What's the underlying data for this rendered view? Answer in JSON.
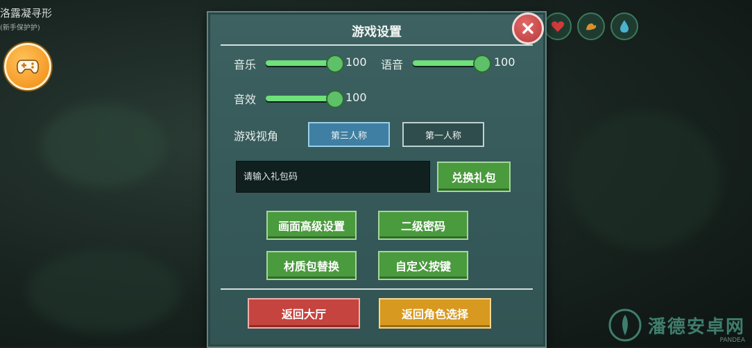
{
  "hud": {
    "quest_title": "洛露凝寻形",
    "quest_subtitle": "(新手保护护)",
    "gamepad_icon": "gamepad-icon",
    "status_icons": [
      "heart-icon",
      "arm-icon",
      "water-drop-icon"
    ]
  },
  "settings": {
    "title": "游戏设置",
    "close_icon": "close-x-icon",
    "music": {
      "label": "音乐",
      "value": "100",
      "level": 1.0
    },
    "voice": {
      "label": "语音",
      "value": "100",
      "level": 1.0
    },
    "sfx": {
      "label": "音效",
      "value": "100",
      "level": 1.0
    },
    "view": {
      "label": "游戏视角",
      "third_person": "第三人称",
      "first_person": "第一人称",
      "selected": "第三人称"
    },
    "gift": {
      "placeholder": "请输入礼包码",
      "redeem_label": "兑换礼包"
    },
    "buttons": {
      "graphics": "画面高级设置",
      "second_password": "二级密码",
      "texture_pack": "材质包替换",
      "custom_keys": "自定义按键"
    },
    "footer": {
      "back_lobby": "返回大厅",
      "back_character": "返回角色选择"
    }
  },
  "watermark": {
    "text": "潘德安卓网",
    "sub": "PANDEA"
  },
  "colors": {
    "panel": "#36595a",
    "slider_fill": "#6fe07a",
    "active_view": "#3f7fa3",
    "green_button": "#4a9a3e",
    "red_button": "#c5443f",
    "orange_button": "#d7991f"
  }
}
